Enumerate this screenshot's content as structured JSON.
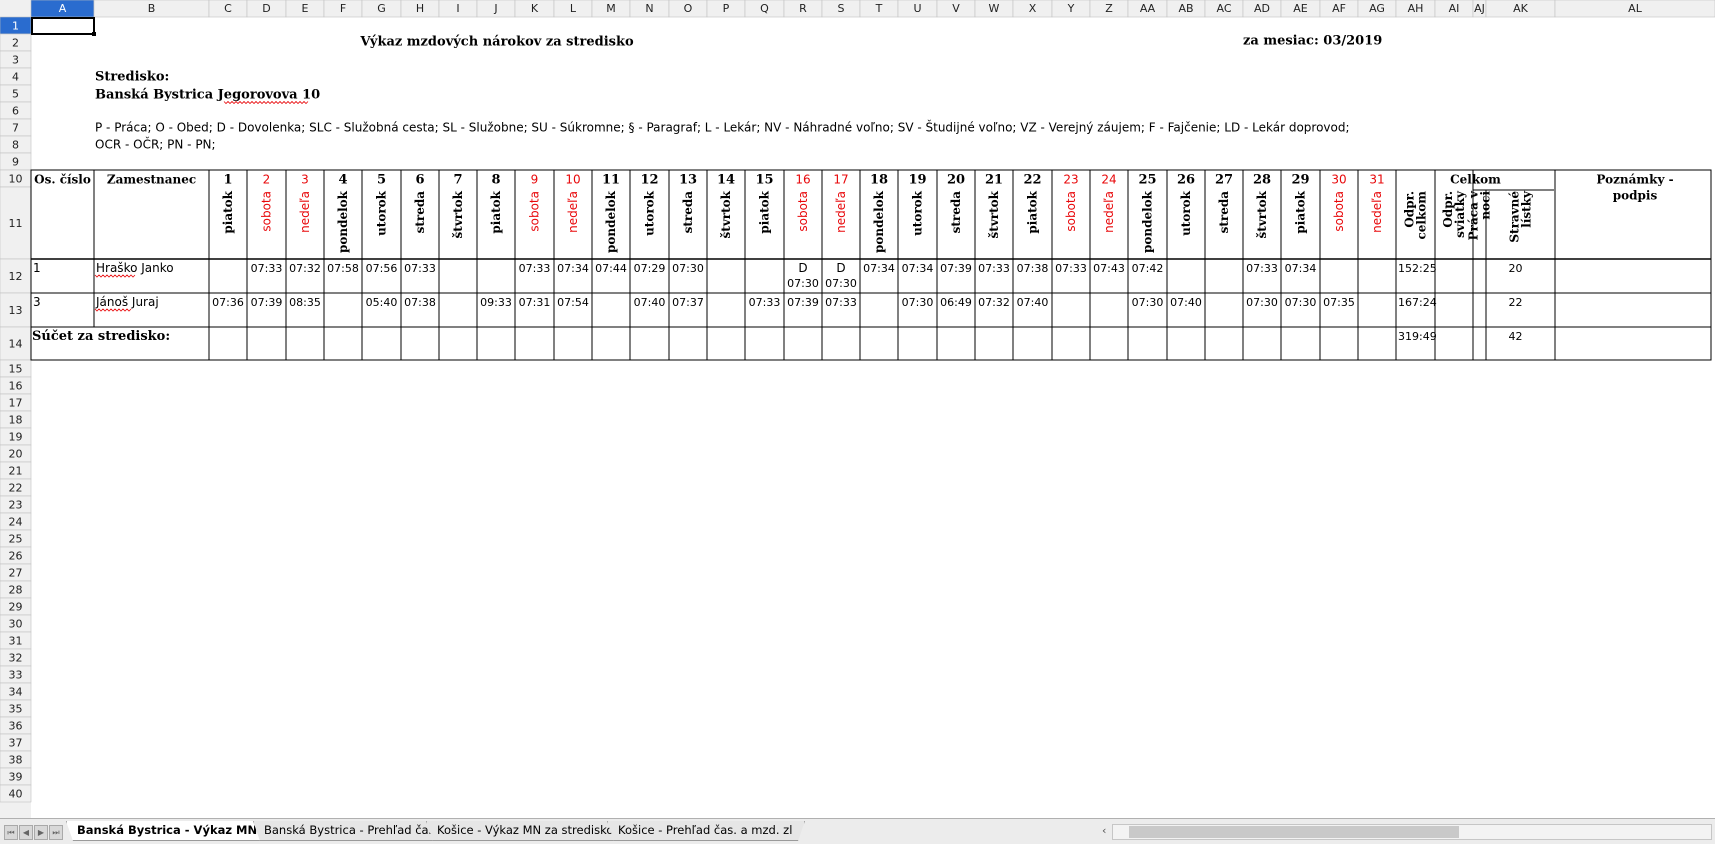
{
  "spreadsheet": {
    "columns": [
      "A",
      "B",
      "C",
      "D",
      "E",
      "F",
      "G",
      "H",
      "I",
      "J",
      "K",
      "L",
      "M",
      "N",
      "O",
      "P",
      "Q",
      "R",
      "S",
      "T",
      "U",
      "V",
      "W",
      "X",
      "Y",
      "Z",
      "AA",
      "AB",
      "AC",
      "AD",
      "AE",
      "AF",
      "AG",
      "AH",
      "AI",
      "AJ",
      "AK",
      "AL"
    ],
    "row_count": 40,
    "selected_cell": "A1",
    "colors": {
      "weekend": "#e8070a",
      "header_bg": "#f0f0f0",
      "selected_header": "#2a6ccf",
      "grid": "#000000"
    }
  },
  "report": {
    "title": "Výkaz mzdových nárokov za stredisko",
    "month": "za mesiac: 03/2019",
    "center_label": "Stredisko:",
    "center_name": "Banská Bystrica Jegorovova 10",
    "legend_line1": "P - Práca; O - Obed; D - Dovolenka; SLC - Služobná cesta; SL - Služobne; SU - Súkromne; § - Paragraf; L - Lekár; NV - Náhradné voľno; SV - Študijné voľno; VZ - Verejný záujem; F - Fajčenie; LD - Lekár doprovod;",
    "legend_line2": "OCR - OČR; PN - PN;"
  },
  "table": {
    "col_os_cislo": "Os. číslo",
    "col_zamestnanec": "Zamestnanec",
    "col_celkom": "Celkom",
    "col_poznamky": "Poznámky - podpis",
    "days": [
      {
        "num": "1",
        "name": "piatok",
        "weekend": false
      },
      {
        "num": "2",
        "name": "sobota",
        "weekend": true
      },
      {
        "num": "3",
        "name": "nedeľa",
        "weekend": true
      },
      {
        "num": "4",
        "name": "pondelok",
        "weekend": false
      },
      {
        "num": "5",
        "name": "utorok",
        "weekend": false
      },
      {
        "num": "6",
        "name": "streda",
        "weekend": false
      },
      {
        "num": "7",
        "name": "štvrtok",
        "weekend": false
      },
      {
        "num": "8",
        "name": "piatok",
        "weekend": false
      },
      {
        "num": "9",
        "name": "sobota",
        "weekend": true
      },
      {
        "num": "10",
        "name": "nedeľa",
        "weekend": true
      },
      {
        "num": "11",
        "name": "pondelok",
        "weekend": false
      },
      {
        "num": "12",
        "name": "utorok",
        "weekend": false
      },
      {
        "num": "13",
        "name": "streda",
        "weekend": false
      },
      {
        "num": "14",
        "name": "štvrtok",
        "weekend": false
      },
      {
        "num": "15",
        "name": "piatok",
        "weekend": false
      },
      {
        "num": "16",
        "name": "sobota",
        "weekend": true
      },
      {
        "num": "17",
        "name": "nedeľa",
        "weekend": true
      },
      {
        "num": "18",
        "name": "pondelok",
        "weekend": false
      },
      {
        "num": "19",
        "name": "utorok",
        "weekend": false
      },
      {
        "num": "20",
        "name": "streda",
        "weekend": false
      },
      {
        "num": "21",
        "name": "štvrtok",
        "weekend": false
      },
      {
        "num": "22",
        "name": "piatok",
        "weekend": false
      },
      {
        "num": "23",
        "name": "sobota",
        "weekend": true
      },
      {
        "num": "24",
        "name": "nedeľa",
        "weekend": true
      },
      {
        "num": "25",
        "name": "pondelok",
        "weekend": false
      },
      {
        "num": "26",
        "name": "utorok",
        "weekend": false
      },
      {
        "num": "27",
        "name": "streda",
        "weekend": false
      },
      {
        "num": "28",
        "name": "štvrtok",
        "weekend": false
      },
      {
        "num": "29",
        "name": "piatok",
        "weekend": false
      },
      {
        "num": "30",
        "name": "sobota",
        "weekend": true
      },
      {
        "num": "31",
        "name": "nedeľa",
        "weekend": true
      }
    ],
    "total_cols": [
      [
        "Odpr.",
        "celkom"
      ],
      [
        "Odpr.",
        "sviatky"
      ],
      [
        "Práca v",
        "noci"
      ],
      [
        "Stravné",
        "lístky"
      ]
    ],
    "rows": [
      {
        "os": "1",
        "name": "Hraško Janko",
        "days": [
          "",
          "07:33",
          "07:32",
          "07:58",
          "07:56",
          "07:33",
          "",
          "",
          "07:33",
          "07:34",
          "07:44",
          "07:29",
          "07:30",
          "",
          "",
          "D|07:30",
          "D|07:30",
          "07:34",
          "07:34",
          "07:39",
          "07:33",
          "07:38",
          "07:33",
          "07:43",
          "07:42",
          "",
          "",
          "07:33",
          "07:34",
          "",
          ""
        ],
        "totals": [
          "152:25",
          "",
          "",
          "20"
        ]
      },
      {
        "os": "3",
        "name": "Jánoš Juraj",
        "days": [
          "07:36",
          "07:39",
          "08:35",
          "",
          "05:40",
          "07:38",
          "",
          "09:33",
          "07:31",
          "07:54",
          "",
          "07:40",
          "07:37",
          "",
          "07:33",
          "07:39",
          "07:33",
          "",
          "07:30",
          "06:49",
          "07:32",
          "07:40",
          "",
          "",
          "07:30",
          "07:40",
          "",
          "07:30",
          "07:30",
          "07:35",
          ""
        ],
        "totals": [
          "167:24",
          "",
          "",
          "22"
        ]
      }
    ],
    "sum_label": "Súčet za stredisko:",
    "sum_totals": [
      "319:49",
      "",
      "",
      "42"
    ]
  },
  "sheet_tabs": [
    "Banská Bystrica - Výkaz MN za s",
    "Banská Bystrica - Prehľad čas.",
    "Košice - Výkaz MN za stredisko",
    "Košice - Prehľad čas. a mzd. zl"
  ],
  "active_tab": 0
}
